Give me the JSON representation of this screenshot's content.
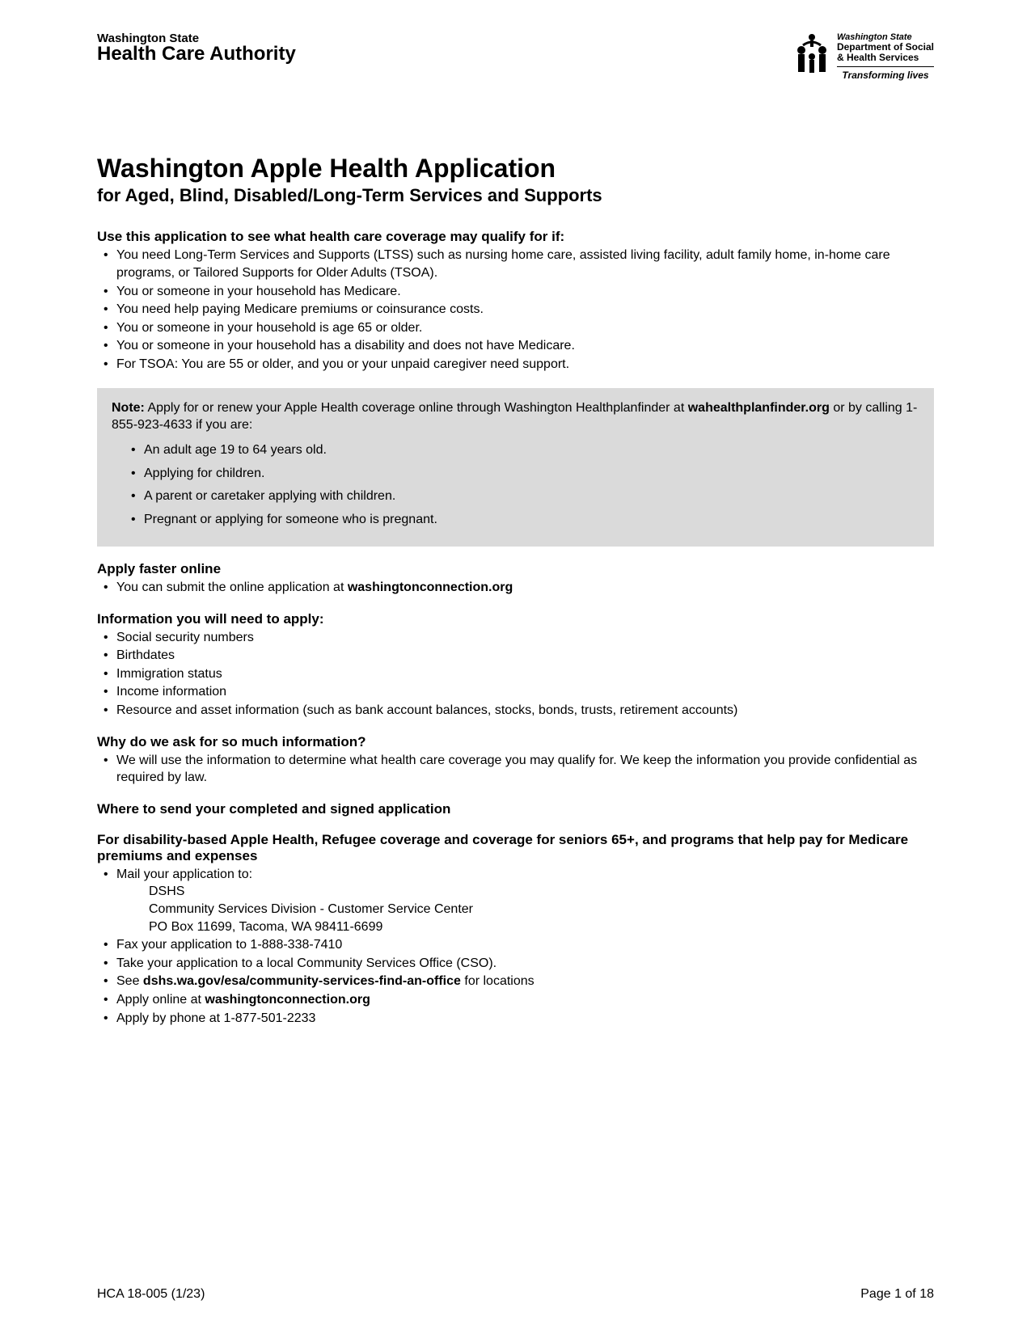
{
  "header": {
    "left_logo_line1": "Washington State",
    "left_logo_line2": "Health Care Authority",
    "right_state": "Washington State",
    "right_dept1": "Department of Social",
    "right_dept2": "& Health Services",
    "right_tagline": "Transforming lives"
  },
  "title": "Washington Apple Health Application",
  "subtitle": "for Aged, Blind, Disabled/Long-Term Services and Supports",
  "use_heading": "Use this application to see what health care coverage may qualify for if:",
  "use_list": [
    "You need Long-Term Services and Supports (LTSS) such as nursing home care, assisted living facility, adult family home, in-home care programs, or Tailored Supports for Older Adults (TSOA).",
    "You or someone in your household has Medicare.",
    "You need help paying Medicare premiums or coinsurance costs.",
    "You or someone in your household is age 65 or older.",
    "You or someone in your household has a disability and does not have Medicare.",
    "For TSOA: You are 55 or older, and you or your unpaid caregiver need support."
  ],
  "note": {
    "label": "Note:",
    "lead1": "Apply for or renew your Apple Health coverage online through Washington Healthplanfinder at ",
    "link": "wahealthplanfinder.org",
    "lead2": " or by calling 1-855-923-4633 if you are:",
    "items": [
      "An adult age 19 to 64 years old.",
      "Applying for children.",
      "A parent or caretaker applying with children.",
      "Pregnant or applying for someone who is pregnant."
    ]
  },
  "apply_faster": {
    "heading": "Apply faster online",
    "text1": "You can submit the online application at ",
    "link": "washingtonconnection.org"
  },
  "info_needed": {
    "heading": "Information you will need to apply:",
    "items": [
      "Social security numbers",
      "Birthdates",
      "Immigration status",
      "Income information",
      "Resource and asset information (such as bank account balances, stocks, bonds, trusts, retirement accounts)"
    ]
  },
  "why": {
    "heading": "Why do we ask for so much information?",
    "text": "We will use the information to determine what health care coverage you may qualify for. We keep the information you provide confidential as required by law."
  },
  "where_heading": "Where to send your completed and signed application",
  "disability": {
    "heading": "For disability-based Apple Health, Refugee coverage and coverage for seniors 65+, and programs that help pay for Medicare premiums and expenses",
    "mail_intro": "Mail your application to:",
    "addr1": "DSHS",
    "addr2": "Community Services Division - Customer Service Center",
    "addr3": "PO Box 11699, Tacoma, WA 98411-6699",
    "fax": "Fax your application to 1-888-338-7410",
    "take": "Take your application to a local Community Services Office (CSO).",
    "see_prefix": "See ",
    "see_link": "dshs.wa.gov/esa/community-services-find-an-office",
    "see_suffix": " for locations",
    "online_prefix": "Apply online at ",
    "online_link": "washingtonconnection.org",
    "phone": "Apply by phone at  1-877-501-2233"
  },
  "footer": {
    "form_id": "HCA 18-005 (1/23)",
    "page": "Page 1 of 18"
  }
}
